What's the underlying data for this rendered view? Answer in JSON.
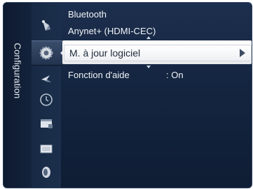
{
  "panel": {
    "section_title": "Configuration"
  },
  "menu": {
    "items": [
      {
        "label": "Bluetooth"
      },
      {
        "label": "Anynet+ (HDMI-CEC)"
      },
      {
        "label": "M. à jour logiciel"
      },
      {
        "label": "Fonction d'aide",
        "value": ": On"
      }
    ],
    "selected_index": 2
  },
  "icons": [
    {
      "name": "picture-icon"
    },
    {
      "name": "setup-gear-icon"
    },
    {
      "name": "input-icon"
    },
    {
      "name": "clock-icon"
    },
    {
      "name": "channel-list-icon"
    },
    {
      "name": "tv-screen-icon"
    },
    {
      "name": "sound-icon"
    }
  ],
  "colors": {
    "panel_bg": "#142540",
    "highlight_bg": "#f5f6f7",
    "text": "#f2f4f8",
    "highlight_text": "#1f2b3b"
  }
}
